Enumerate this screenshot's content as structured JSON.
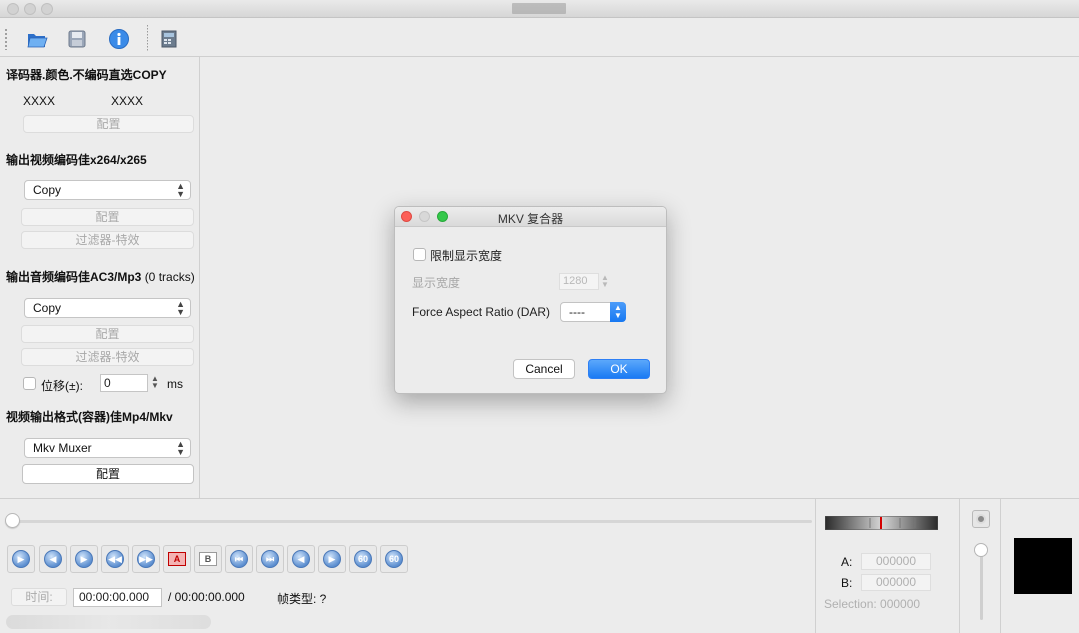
{
  "titlebar": {
    "title": ""
  },
  "toolbar": {
    "items": [
      {
        "name": "open-folder-icon"
      },
      {
        "name": "save-disk-icon"
      },
      {
        "name": "info-icon"
      },
      {
        "name": "film-calculator-icon"
      }
    ]
  },
  "left_panel": {
    "decoder": {
      "title": "译码器.颜色.不编码直选COPY",
      "left_label": "XXXX",
      "right_label": "XXXX",
      "config_button": "配置"
    },
    "video": {
      "title": "输出视频编码佳x264/x265",
      "codec_value": "Copy",
      "config_button": "配置",
      "filter_button": "过滤器-特效"
    },
    "audio": {
      "title": "输出音频编码佳AC3/Mp3",
      "tracks": "(0 tracks)",
      "codec_value": "Copy",
      "config_button": "配置",
      "filter_button": "过滤器-特效",
      "shift_label": "位移(±):",
      "shift_value": "0",
      "shift_unit": "ms"
    },
    "container": {
      "title": "视频输出格式(容器)佳Mp4/Mkv",
      "muxer_value": "Mkv Muxer",
      "config_button": "配置"
    }
  },
  "dialog": {
    "title": "MKV 复合器",
    "limit_width_label": "限制显示宽度",
    "display_width_label": "显示宽度",
    "display_width_value": "1280",
    "dar_label": "Force Aspect Ratio (DAR)",
    "dar_value": "----",
    "cancel_label": "Cancel",
    "ok_label": "OK"
  },
  "controls": {
    "buttons": [
      {
        "name": "play-button",
        "glyph": "▶",
        "kind": "disc"
      },
      {
        "name": "rewind-button",
        "glyph": "◀",
        "kind": "disc"
      },
      {
        "name": "forward-button",
        "glyph": "▶",
        "kind": "disc"
      },
      {
        "name": "prev-keyframe-button",
        "glyph": "◀◀",
        "kind": "disc"
      },
      {
        "name": "next-keyframe-button",
        "glyph": "▶▶",
        "kind": "disc"
      },
      {
        "name": "set-marker-a-button",
        "glyph": "A",
        "kind": "box-red"
      },
      {
        "name": "set-marker-b-button",
        "glyph": "B",
        "kind": "box"
      },
      {
        "name": "goto-start-button",
        "glyph": "⏮",
        "kind": "disc"
      },
      {
        "name": "goto-end-button",
        "glyph": "⏭",
        "kind": "disc"
      },
      {
        "name": "goto-marker-a-button",
        "glyph": "◀",
        "kind": "disc"
      },
      {
        "name": "goto-marker-b-button",
        "glyph": "▶",
        "kind": "disc"
      },
      {
        "name": "back-60-button",
        "glyph": "60",
        "kind": "disc"
      },
      {
        "name": "forward-60-button",
        "glyph": "60",
        "kind": "disc"
      }
    ],
    "time_label": "时间:",
    "current_time": "00:00:00.000",
    "total_time": "/ 00:00:00.000",
    "frame_type_label": "帧类型: ?"
  },
  "selection": {
    "a_label": "A:",
    "a_value": "000000",
    "b_label": "B:",
    "b_value": "000000",
    "selection_label": "Selection: 000000"
  },
  "colors": {
    "accent": "#1a7af3",
    "close": "#fc5f57",
    "minimize": "#d8d8d8",
    "zoom": "#34c84a",
    "marker": "#d40000"
  }
}
